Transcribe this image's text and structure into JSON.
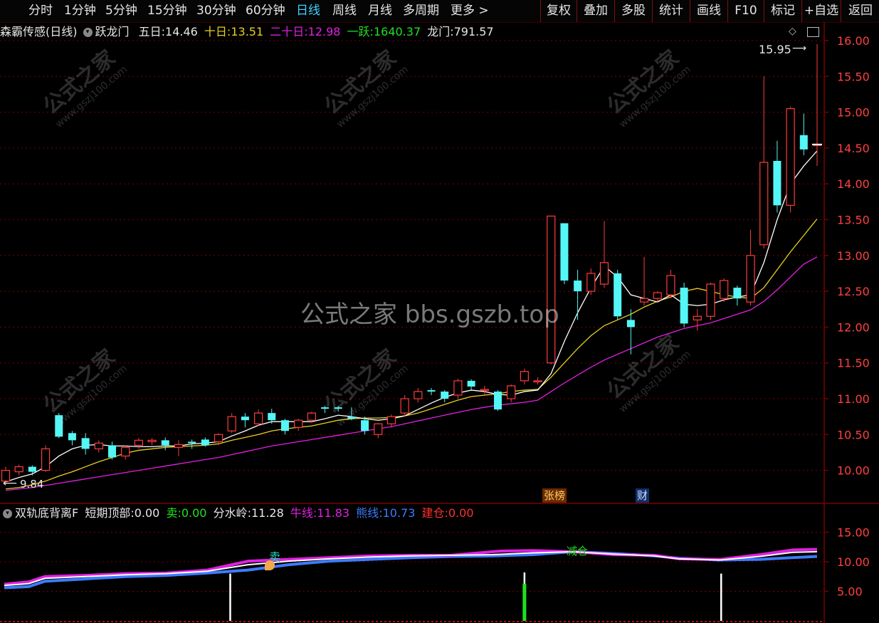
{
  "toolbar": {
    "periods": [
      "分时",
      "1分钟",
      "5分钟",
      "15分钟",
      "30分钟",
      "60分钟",
      "日线",
      "周线",
      "月线",
      "多周期",
      "更多 >"
    ],
    "active_period": "日线",
    "actions": [
      "复权",
      "叠加",
      "多股",
      "统计",
      "画线",
      "F10",
      "标记",
      "+自选",
      "返回"
    ]
  },
  "main_info": {
    "title": "森霸传感(日线)",
    "indicator": "跃龙门",
    "ma5_label": "五日:",
    "ma5_value": "14.46",
    "ma10_label": "十日:",
    "ma10_value": "13.51",
    "ma20_label": "二十日:",
    "ma20_value": "12.98",
    "yiyue_label": "一跃:",
    "yiyue_value": "1640.37",
    "longmen_label": "龙门:",
    "longmen_value": "791.57"
  },
  "price_axis": [
    "16.00",
    "15.50",
    "15.00",
    "14.50",
    "14.00",
    "13.50",
    "13.00",
    "12.50",
    "12.00",
    "11.50",
    "11.00",
    "10.50",
    "10.00"
  ],
  "annotations": {
    "high_label": "15.95",
    "low_label": "9.84",
    "event_zhangbang": "张榜",
    "event_cai": "财",
    "sell_marker": "卖",
    "reduce_marker": "减仓"
  },
  "watermark": {
    "center": "公式之家 bbs.gszb.top",
    "seal_title": "公式之家",
    "seal_url": "www.gszj100.com"
  },
  "sub_info": {
    "name": "双轨底背离F",
    "short_top_label": "短期顶部:",
    "short_top_value": "0.00",
    "sell_label": "卖:",
    "sell_value": "0.00",
    "watershed_label": "分水岭:",
    "watershed_value": "11.28",
    "bull_label": "牛线:",
    "bull_value": "11.83",
    "bear_label": "熊线:",
    "bear_value": "10.73",
    "build_label": "建仓:",
    "build_value": "0.00"
  },
  "sub_axis": [
    "15.00",
    "10.00",
    "5.00"
  ],
  "colors": {
    "up": "#ff3c3c",
    "down": "#54f6f6",
    "ma5": "#ffffff",
    "ma10": "#e8d020",
    "ma20": "#e020e0",
    "bull": "#e020e0",
    "bear": "#3c7cff",
    "grid": "#7a0000"
  },
  "chart_data": {
    "type": "candlestick",
    "y_range": [
      9.7,
      16.1
    ],
    "candles": [
      [
        9.85,
        10.0,
        9.8,
        10.05
      ],
      [
        9.98,
        10.05,
        9.93,
        10.08
      ],
      [
        10.05,
        9.98,
        9.93,
        10.07
      ],
      [
        10.0,
        10.3,
        9.98,
        10.35
      ],
      [
        10.77,
        10.47,
        10.45,
        10.8
      ],
      [
        10.52,
        10.42,
        10.35,
        10.55
      ],
      [
        10.45,
        10.3,
        10.22,
        10.52
      ],
      [
        10.3,
        10.38,
        10.25,
        10.42
      ],
      [
        10.35,
        10.18,
        10.15,
        10.4
      ],
      [
        10.2,
        10.32,
        10.15,
        10.35
      ],
      [
        10.35,
        10.42,
        10.3,
        10.45
      ],
      [
        10.4,
        10.42,
        10.35,
        10.45
      ],
      [
        10.42,
        10.35,
        10.28,
        10.46
      ],
      [
        10.32,
        10.36,
        10.2,
        10.42
      ],
      [
        10.4,
        10.38,
        10.3,
        10.43
      ],
      [
        10.43,
        10.35,
        10.33,
        10.46
      ],
      [
        10.4,
        10.5,
        10.35,
        10.52
      ],
      [
        10.55,
        10.75,
        10.52,
        10.8
      ],
      [
        10.75,
        10.7,
        10.6,
        10.8
      ],
      [
        10.65,
        10.8,
        10.62,
        10.85
      ],
      [
        10.8,
        10.7,
        10.65,
        10.86
      ],
      [
        10.7,
        10.55,
        10.5,
        10.72
      ],
      [
        10.6,
        10.7,
        10.55,
        10.72
      ],
      [
        10.7,
        10.8,
        10.66,
        10.82
      ],
      [
        10.88,
        10.86,
        10.8,
        10.9
      ],
      [
        10.88,
        10.86,
        10.82,
        10.9
      ],
      [
        10.75,
        10.72,
        10.7,
        10.88
      ],
      [
        10.7,
        10.55,
        10.5,
        10.75
      ],
      [
        10.5,
        10.65,
        10.45,
        10.66
      ],
      [
        10.65,
        10.75,
        10.6,
        10.78
      ],
      [
        10.8,
        11.0,
        10.75,
        11.05
      ],
      [
        11.0,
        11.1,
        10.95,
        11.15
      ],
      [
        11.12,
        11.1,
        11.05,
        11.15
      ],
      [
        11.1,
        11.0,
        10.95,
        11.12
      ],
      [
        11.05,
        11.25,
        11.0,
        11.28
      ],
      [
        11.25,
        11.17,
        11.12,
        11.27
      ],
      [
        11.13,
        11.13,
        11.05,
        11.18
      ],
      [
        11.1,
        10.85,
        10.83,
        11.12
      ],
      [
        11.0,
        11.18,
        10.95,
        11.2
      ],
      [
        11.25,
        11.38,
        11.2,
        11.42
      ],
      [
        11.25,
        11.25,
        11.2,
        11.3
      ],
      [
        11.5,
        13.55,
        11.48,
        13.55
      ],
      [
        13.45,
        12.65,
        12.6,
        13.45
      ],
      [
        12.65,
        12.5,
        12.1,
        12.8
      ],
      [
        12.5,
        12.75,
        12.45,
        12.82
      ],
      [
        12.6,
        12.9,
        12.55,
        13.48
      ],
      [
        12.75,
        12.15,
        12.1,
        12.8
      ],
      [
        12.1,
        12.0,
        11.62,
        12.25
      ],
      [
        12.35,
        12.4,
        12.3,
        12.98
      ],
      [
        12.4,
        12.48,
        12.35,
        12.5
      ],
      [
        12.45,
        12.72,
        12.4,
        12.8
      ],
      [
        12.55,
        12.05,
        12.0,
        12.62
      ],
      [
        12.1,
        12.15,
        11.95,
        12.25
      ],
      [
        12.15,
        12.6,
        12.1,
        12.62
      ],
      [
        12.4,
        12.65,
        12.35,
        12.68
      ],
      [
        12.55,
        12.4,
        12.3,
        12.58
      ],
      [
        12.35,
        13.0,
        12.3,
        13.36
      ],
      [
        13.15,
        14.3,
        13.1,
        15.5
      ],
      [
        14.32,
        13.7,
        13.6,
        14.6
      ],
      [
        13.7,
        15.05,
        13.6,
        15.08
      ],
      [
        14.68,
        14.48,
        14.4,
        14.98
      ],
      [
        14.55,
        14.55,
        14.25,
        15.95
      ]
    ],
    "ma5": [
      9.84,
      9.9,
      9.95,
      10.05,
      10.2,
      10.3,
      10.35,
      10.36,
      10.34,
      10.34,
      10.33,
      10.33,
      10.34,
      10.34,
      10.37,
      10.38,
      10.4,
      10.48,
      10.55,
      10.63,
      10.68,
      10.68,
      10.68,
      10.68,
      10.72,
      10.77,
      10.75,
      10.72,
      10.7,
      10.72,
      10.76,
      10.85,
      10.94,
      11.02,
      11.08,
      11.12,
      11.1,
      11.06,
      11.05,
      11.1,
      11.12,
      11.35,
      11.8,
      12.2,
      12.55,
      12.85,
      12.7,
      12.45,
      12.4,
      12.35,
      12.45,
      12.32,
      12.3,
      12.32,
      12.38,
      12.42,
      12.45,
      12.9,
      13.5,
      14.0,
      14.25,
      14.46
    ],
    "ma10": [
      9.74,
      9.76,
      9.8,
      9.85,
      9.92,
      9.98,
      10.05,
      10.12,
      10.18,
      10.24,
      10.28,
      10.3,
      10.32,
      10.33,
      10.34,
      10.35,
      10.37,
      10.42,
      10.46,
      10.5,
      10.55,
      10.58,
      10.6,
      10.62,
      10.66,
      10.7,
      10.72,
      10.73,
      10.73,
      10.74,
      10.76,
      10.8,
      10.86,
      10.92,
      10.98,
      11.03,
      11.05,
      11.07,
      11.1,
      11.12,
      11.13,
      11.3,
      11.5,
      11.7,
      11.88,
      12.02,
      12.1,
      12.18,
      12.28,
      12.36,
      12.42,
      12.5,
      12.54,
      12.5,
      12.45,
      12.42,
      12.4,
      12.55,
      12.8,
      13.05,
      13.28,
      13.51
    ],
    "ma20": [
      9.72,
      9.74,
      9.76,
      9.79,
      9.82,
      9.85,
      9.88,
      9.91,
      9.94,
      9.97,
      10.0,
      10.03,
      10.06,
      10.09,
      10.12,
      10.15,
      10.18,
      10.22,
      10.26,
      10.3,
      10.34,
      10.37,
      10.4,
      10.43,
      10.46,
      10.49,
      10.52,
      10.55,
      10.58,
      10.61,
      10.65,
      10.69,
      10.73,
      10.77,
      10.81,
      10.85,
      10.88,
      10.91,
      10.93,
      10.95,
      10.98,
      11.1,
      11.22,
      11.33,
      11.44,
      11.54,
      11.62,
      11.7,
      11.78,
      11.86,
      11.92,
      11.98,
      12.02,
      12.06,
      12.12,
      12.18,
      12.24,
      12.36,
      12.52,
      12.7,
      12.88,
      12.98
    ],
    "sub": {
      "y_range": [
        0,
        18
      ],
      "bull_points": [
        [
          0,
          6.2
        ],
        [
          3,
          6.6
        ],
        [
          5,
          7.5
        ],
        [
          10,
          7.7
        ],
        [
          15,
          8.0
        ],
        [
          20,
          8.1
        ],
        [
          25,
          8.6
        ],
        [
          30,
          10.1
        ],
        [
          35,
          10.4
        ],
        [
          40,
          10.7
        ],
        [
          45,
          11.0
        ],
        [
          50,
          11.1
        ],
        [
          55,
          11.1
        ],
        [
          61,
          11.8
        ],
        [
          65,
          11.9
        ],
        [
          70,
          11.7
        ],
        [
          75,
          11.2
        ],
        [
          80,
          11.1
        ],
        [
          83,
          10.5
        ],
        [
          88,
          10.4
        ],
        [
          93,
          11.2
        ],
        [
          97,
          12.0
        ],
        [
          100,
          12.1
        ]
      ],
      "bear_points": [
        [
          0,
          5.6
        ],
        [
          3,
          5.8
        ],
        [
          5,
          6.7
        ],
        [
          10,
          7.1
        ],
        [
          15,
          7.5
        ],
        [
          20,
          7.7
        ],
        [
          25,
          8.1
        ],
        [
          30,
          8.6
        ],
        [
          35,
          9.5
        ],
        [
          40,
          10.1
        ],
        [
          45,
          10.4
        ],
        [
          50,
          10.7
        ],
        [
          55,
          10.9
        ],
        [
          60,
          11.0
        ],
        [
          65,
          11.2
        ],
        [
          70,
          11.7
        ],
        [
          75,
          11.4
        ],
        [
          80,
          11.0
        ],
        [
          83,
          10.6
        ],
        [
          88,
          10.3
        ],
        [
          93,
          10.4
        ],
        [
          97,
          10.7
        ],
        [
          100,
          10.9
        ]
      ],
      "white_points": [
        [
          0,
          6.0
        ],
        [
          3,
          6.3
        ],
        [
          5,
          7.2
        ],
        [
          10,
          7.5
        ],
        [
          15,
          7.8
        ],
        [
          20,
          8.0
        ],
        [
          25,
          8.4
        ],
        [
          30,
          9.5
        ],
        [
          35,
          10.1
        ],
        [
          40,
          10.5
        ],
        [
          45,
          10.8
        ],
        [
          50,
          11.0
        ],
        [
          55,
          11.1
        ],
        [
          60,
          11.2
        ],
        [
          65,
          11.5
        ],
        [
          70,
          11.7
        ],
        [
          75,
          11.3
        ],
        [
          80,
          11.0
        ],
        [
          83,
          10.5
        ],
        [
          88,
          10.3
        ],
        [
          93,
          10.9
        ],
        [
          97,
          11.6
        ],
        [
          100,
          11.7
        ]
      ],
      "bars": [
        {
          "x": 27.8,
          "value": 8.0,
          "color": "#ffffff"
        },
        {
          "x": 64.0,
          "value": 8.2,
          "color": "#ffffff"
        },
        {
          "x": 64.0,
          "value": 6.3,
          "color": "#20e020"
        },
        {
          "x": 88.2,
          "value": 8.0,
          "color": "#ffffff"
        }
      ]
    }
  }
}
